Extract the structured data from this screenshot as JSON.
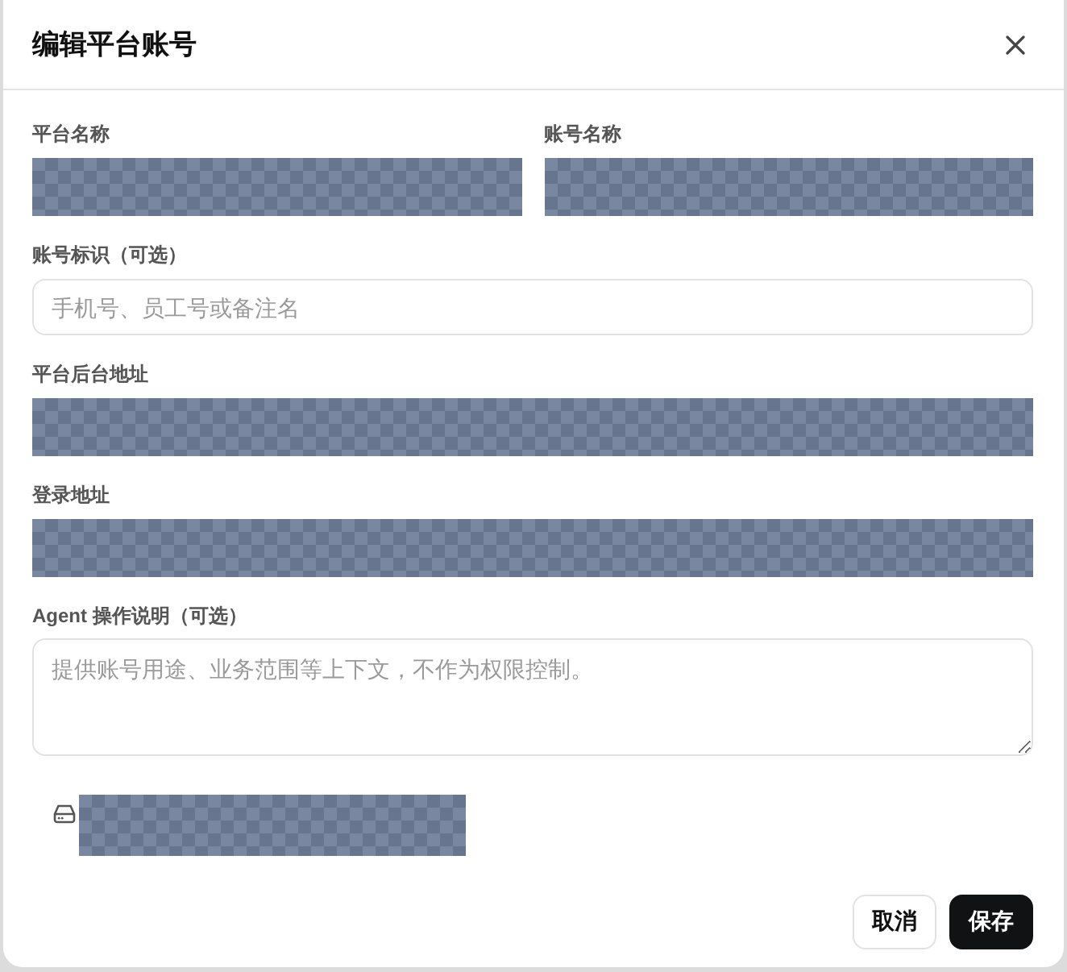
{
  "dialog": {
    "title": "编辑平台账号"
  },
  "rows": [
    {
      "fields": [
        {
          "label": "平台名称",
          "kind": "redacted"
        },
        {
          "label": "账号名称",
          "kind": "redacted"
        }
      ]
    },
    {
      "fields": [
        {
          "label": "账号标识（可选）",
          "kind": "input",
          "placeholder": "手机号、员工号或备注名"
        }
      ]
    },
    {
      "fields": [
        {
          "label": "平台后台地址",
          "kind": "redacted"
        }
      ]
    },
    {
      "fields": [
        {
          "label": "登录地址",
          "kind": "redacted"
        }
      ]
    },
    {
      "fields": [
        {
          "label": "Agent 操作说明（可选）",
          "kind": "textarea",
          "placeholder": "提供账号用途、业务范围等上下文，不作为权限控制。"
        }
      ]
    }
  ],
  "storage_info": {
    "kind": "redacted"
  },
  "buttons": [
    {
      "label": "取消",
      "kind": "secondary"
    },
    {
      "label": "保存",
      "kind": "primary"
    }
  ]
}
